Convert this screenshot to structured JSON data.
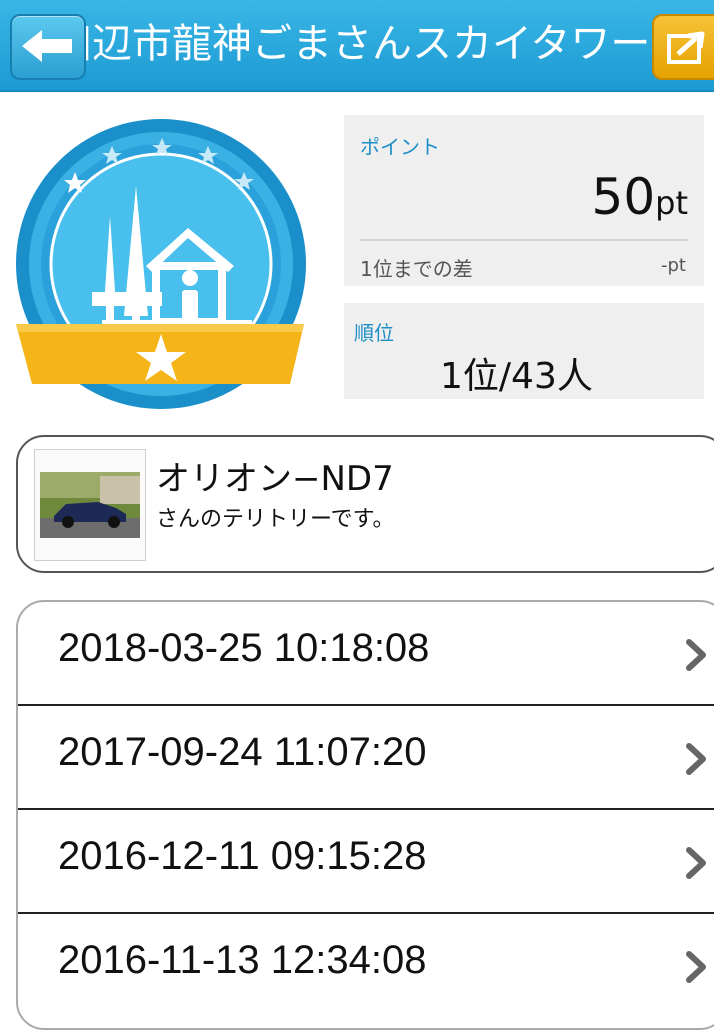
{
  "header": {
    "title": "田辺市龍神ごまさんスカイタワー"
  },
  "stats": {
    "points_label": "ポイント",
    "points_value": "50",
    "points_unit": "pt",
    "diff_label": "1位までの差",
    "diff_value": "-pt",
    "rank_label": "順位",
    "rank_value": "1位/43人"
  },
  "territory": {
    "owner_name": "オリオン−ND7",
    "note": "さんのテリトリーです。"
  },
  "history": [
    {
      "datetime": "2018-03-25 10:18:08"
    },
    {
      "datetime": "2017-09-24 11:07:20"
    },
    {
      "datetime": "2016-12-11 09:15:28"
    },
    {
      "datetime": "2016-11-13 12:34:08"
    }
  ],
  "colors": {
    "header": "#1c9bd3",
    "accent_text": "#1d8fc7",
    "badge_ribbon": "#f5b418",
    "share_button": "#f6c236"
  },
  "icons": {
    "back": "arrow-left-icon",
    "share": "share-icon",
    "chevron": "chevron-right-icon",
    "badge": "territory-badge-icon"
  }
}
